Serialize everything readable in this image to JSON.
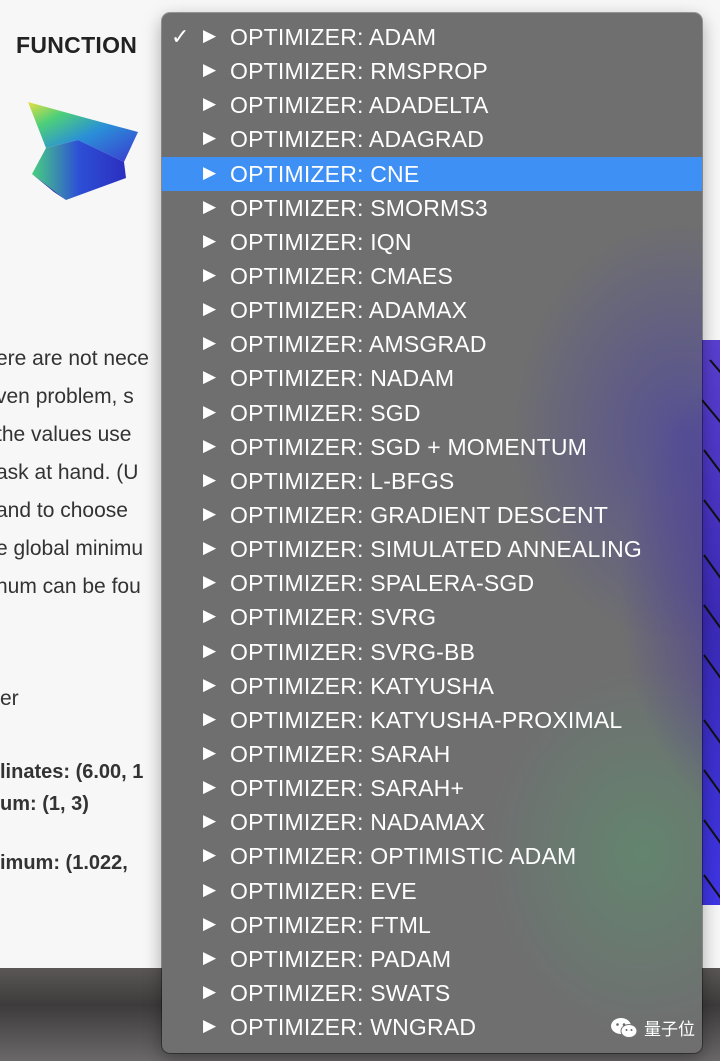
{
  "page": {
    "heading": "FUNCTION",
    "text_lines": [
      "ere are not nece",
      "ven problem, s",
      " the values use",
      "ask at hand. (U",
      " and to choose",
      "e global minimu",
      "num can be fou"
    ],
    "label_er": "er",
    "bold_lines": [
      "linates: (6.00, 1",
      "um: (1, 3)",
      "imum: (1.022,"
    ]
  },
  "menu": {
    "checkmark": "✓",
    "arrow": "▶",
    "selected_index": 0,
    "highlighted_index": 4,
    "items": [
      "OPTIMIZER: ADAM",
      "OPTIMIZER: RMSPROP",
      "OPTIMIZER: ADADELTA",
      "OPTIMIZER: ADAGRAD",
      "OPTIMIZER: CNE",
      "OPTIMIZER: SMORMS3",
      "OPTIMIZER: IQN",
      "OPTIMIZER: CMAES",
      "OPTIMIZER: ADAMAX",
      "OPTIMIZER: AMSGRAD",
      "OPTIMIZER: NADAM",
      "OPTIMIZER: SGD",
      "OPTIMIZER: SGD + MOMENTUM",
      "OPTIMIZER: L-BFGS",
      "OPTIMIZER: GRADIENT DESCENT",
      "OPTIMIZER: SIMULATED ANNEALING",
      "OPTIMIZER: SPALERA-SGD",
      "OPTIMIZER: SVRG",
      "OPTIMIZER: SVRG-BB",
      "OPTIMIZER: KATYUSHA",
      "OPTIMIZER: KATYUSHA-PROXIMAL",
      "OPTIMIZER: SARAH",
      "OPTIMIZER: SARAH+",
      "OPTIMIZER: NADAMAX",
      "OPTIMIZER: OPTIMISTIC ADAM",
      "OPTIMIZER: EVE",
      "OPTIMIZER: FTML",
      "OPTIMIZER: PADAM",
      "OPTIMIZER: SWATS",
      "OPTIMIZER: WNGRAD"
    ]
  },
  "watermark": {
    "icon": "wechat-icon",
    "text": "量子位"
  },
  "colors": {
    "highlight": "#3f90f5",
    "menu_bg": "#6f6f70"
  }
}
